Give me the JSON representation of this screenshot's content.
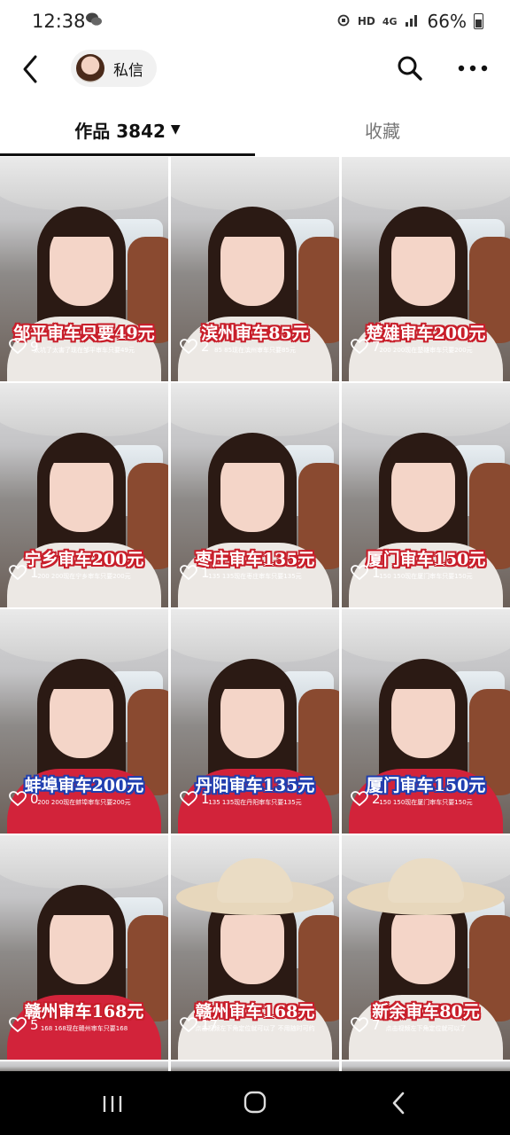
{
  "status_bar": {
    "time": "12:38",
    "hd": "HD",
    "network": "4G",
    "battery": "66%"
  },
  "header": {
    "dm_label": "私信"
  },
  "tabs": {
    "works_label": "作品 3842",
    "favorites_label": "收藏"
  },
  "videos": [
    {
      "caption": "邹平审车只要49元",
      "subtitle": "太坑了太害了现在邹平审车只要49元",
      "likes": "9",
      "style": "red"
    },
    {
      "caption": "滨州审车85元",
      "subtitle": "85 85现在滨州审车只要85元",
      "likes": "2",
      "style": "red"
    },
    {
      "caption": "楚雄审车200元",
      "subtitle": "200 200现在楚雄审车只要200元",
      "likes": "7",
      "style": "red"
    },
    {
      "caption": "宁乡审车200元",
      "subtitle": "200 200现在宁乡审车只要200元",
      "likes": "1",
      "style": "red"
    },
    {
      "caption": "枣庄审车135元",
      "subtitle": "135 135现在枣庄审车只要135元",
      "likes": "1",
      "style": "red"
    },
    {
      "caption": "厦门审车150元",
      "subtitle": "150 150现在厦门审车只要150元",
      "likes": "1",
      "style": "red"
    },
    {
      "caption": "蚌埠审车200元",
      "subtitle": "200 200现在蚌埠审车只要200元",
      "likes": "0",
      "style": "blue"
    },
    {
      "caption": "丹阳审车135元",
      "subtitle": "135 135现在丹阳审车只要135元",
      "likes": "1",
      "style": "blue"
    },
    {
      "caption": "厦门审车150元",
      "subtitle": "150 150现在厦门审车只要150元",
      "likes": "2",
      "style": "blue"
    },
    {
      "caption": "赣州审车168元",
      "subtitle": "168 168现在赣州审车只要168",
      "likes": "5",
      "style": "red"
    },
    {
      "caption": "赣州审车168元",
      "subtitle": "点击视频左下角定位就可以了 不用随时可约",
      "likes": "17",
      "style": "red"
    },
    {
      "caption": "新余审车80元",
      "subtitle": "点击视频左下角定位就可以了",
      "likes": "7",
      "style": "red"
    }
  ]
}
